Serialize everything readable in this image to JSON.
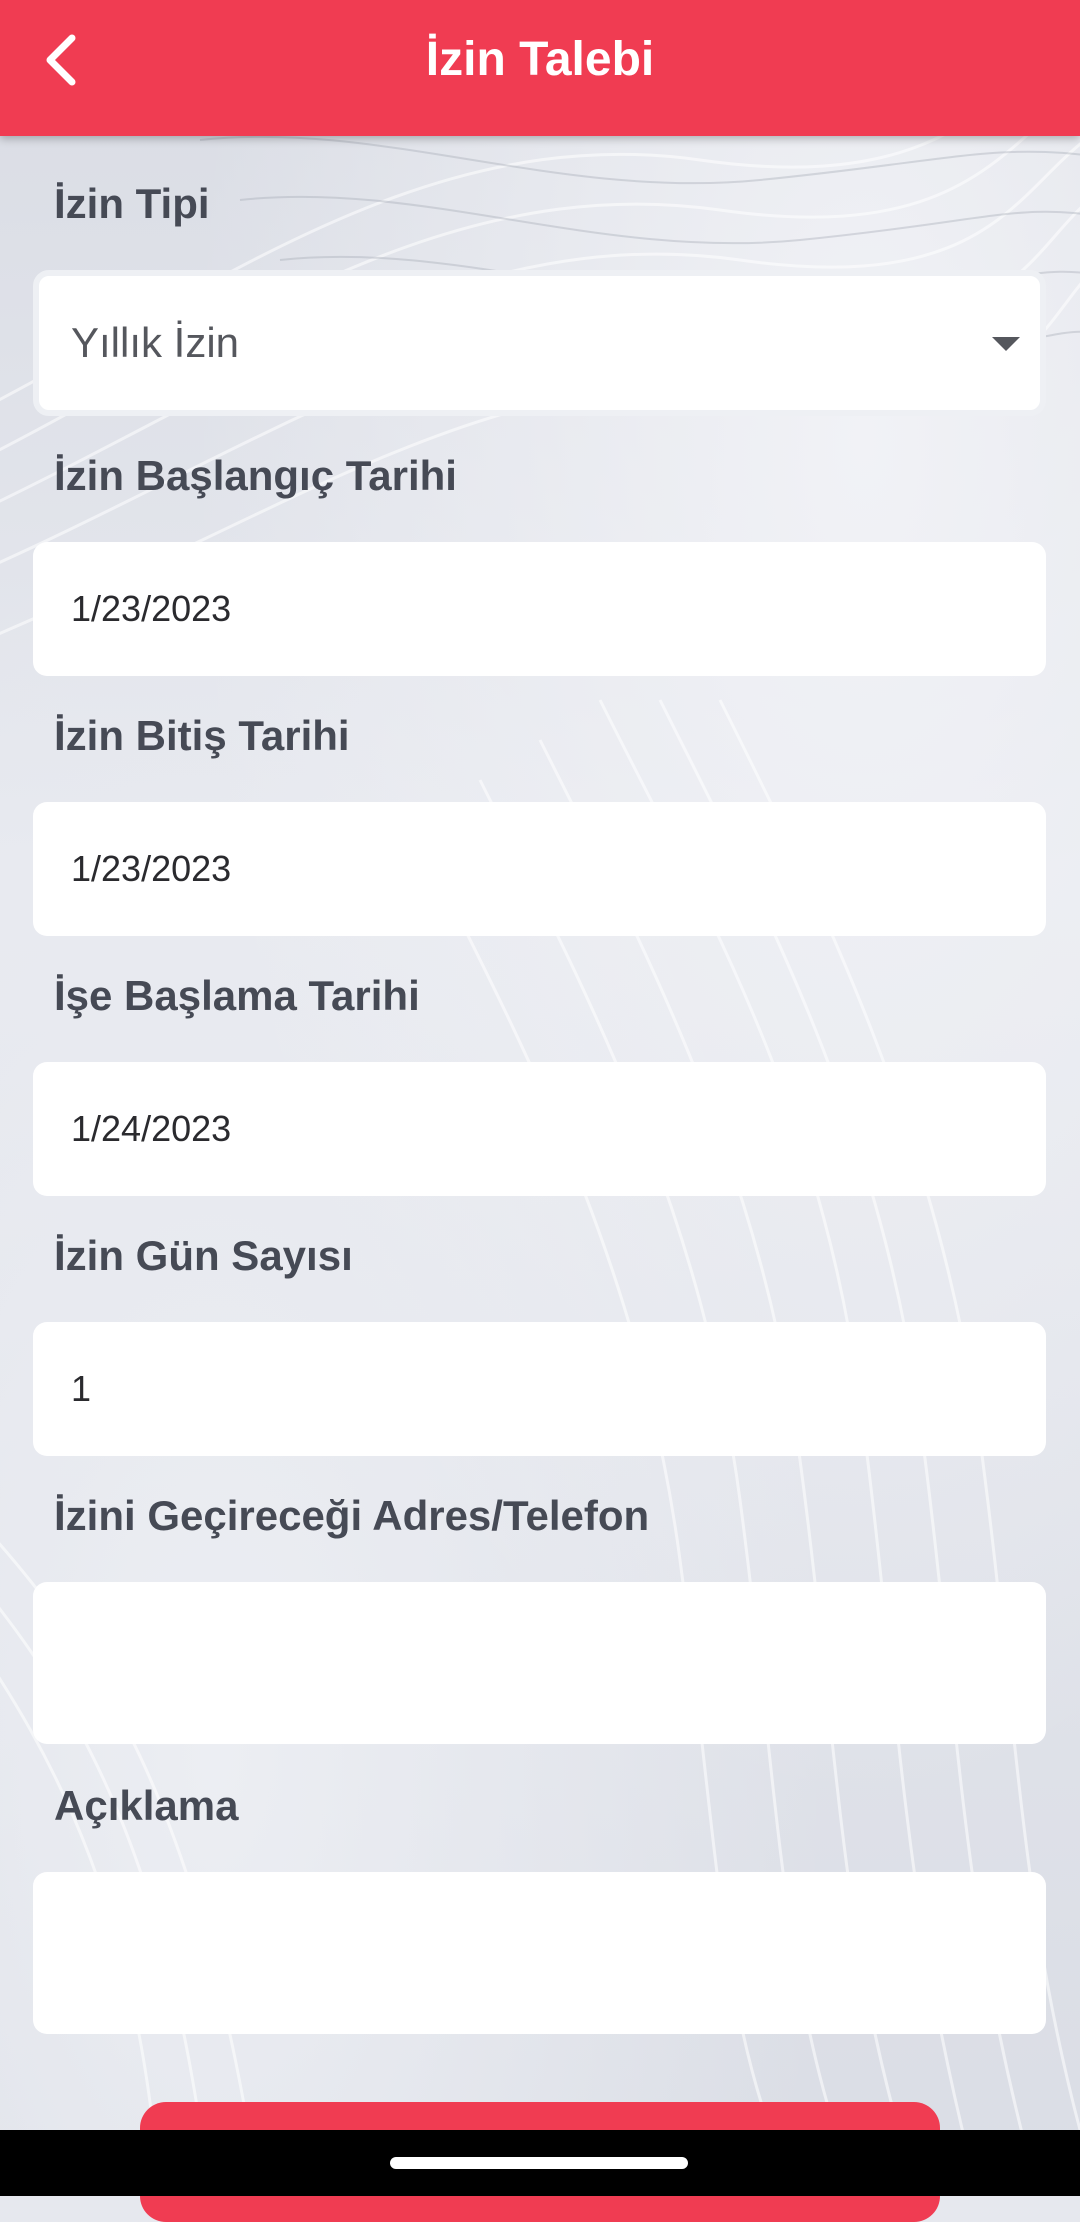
{
  "app_bar": {
    "title": "İzin Talebi",
    "back_icon": "chevron-left-icon",
    "color": "#f03c52"
  },
  "form": {
    "leave_type": {
      "label": "İzin Tipi",
      "value": "Yıllık İzin",
      "icon": "caret-down-icon"
    },
    "start_date": {
      "label": "İzin Başlangıç Tarihi",
      "value": "1/23/2023"
    },
    "end_date": {
      "label": "İzin Bitiş Tarihi",
      "value": "1/23/2023"
    },
    "return_date": {
      "label": "İşe Başlama Tarihi",
      "value": "1/24/2023"
    },
    "day_count": {
      "label": "İzin Gün Sayısı",
      "value": "1"
    },
    "address_phone": {
      "label": "İzini Geçireceği Adres/Telefon",
      "value": ""
    },
    "description": {
      "label": "Açıklama",
      "value": ""
    }
  },
  "colors": {
    "accent": "#f03c52",
    "label_text": "#464a55",
    "field_bg": "#ffffff"
  }
}
